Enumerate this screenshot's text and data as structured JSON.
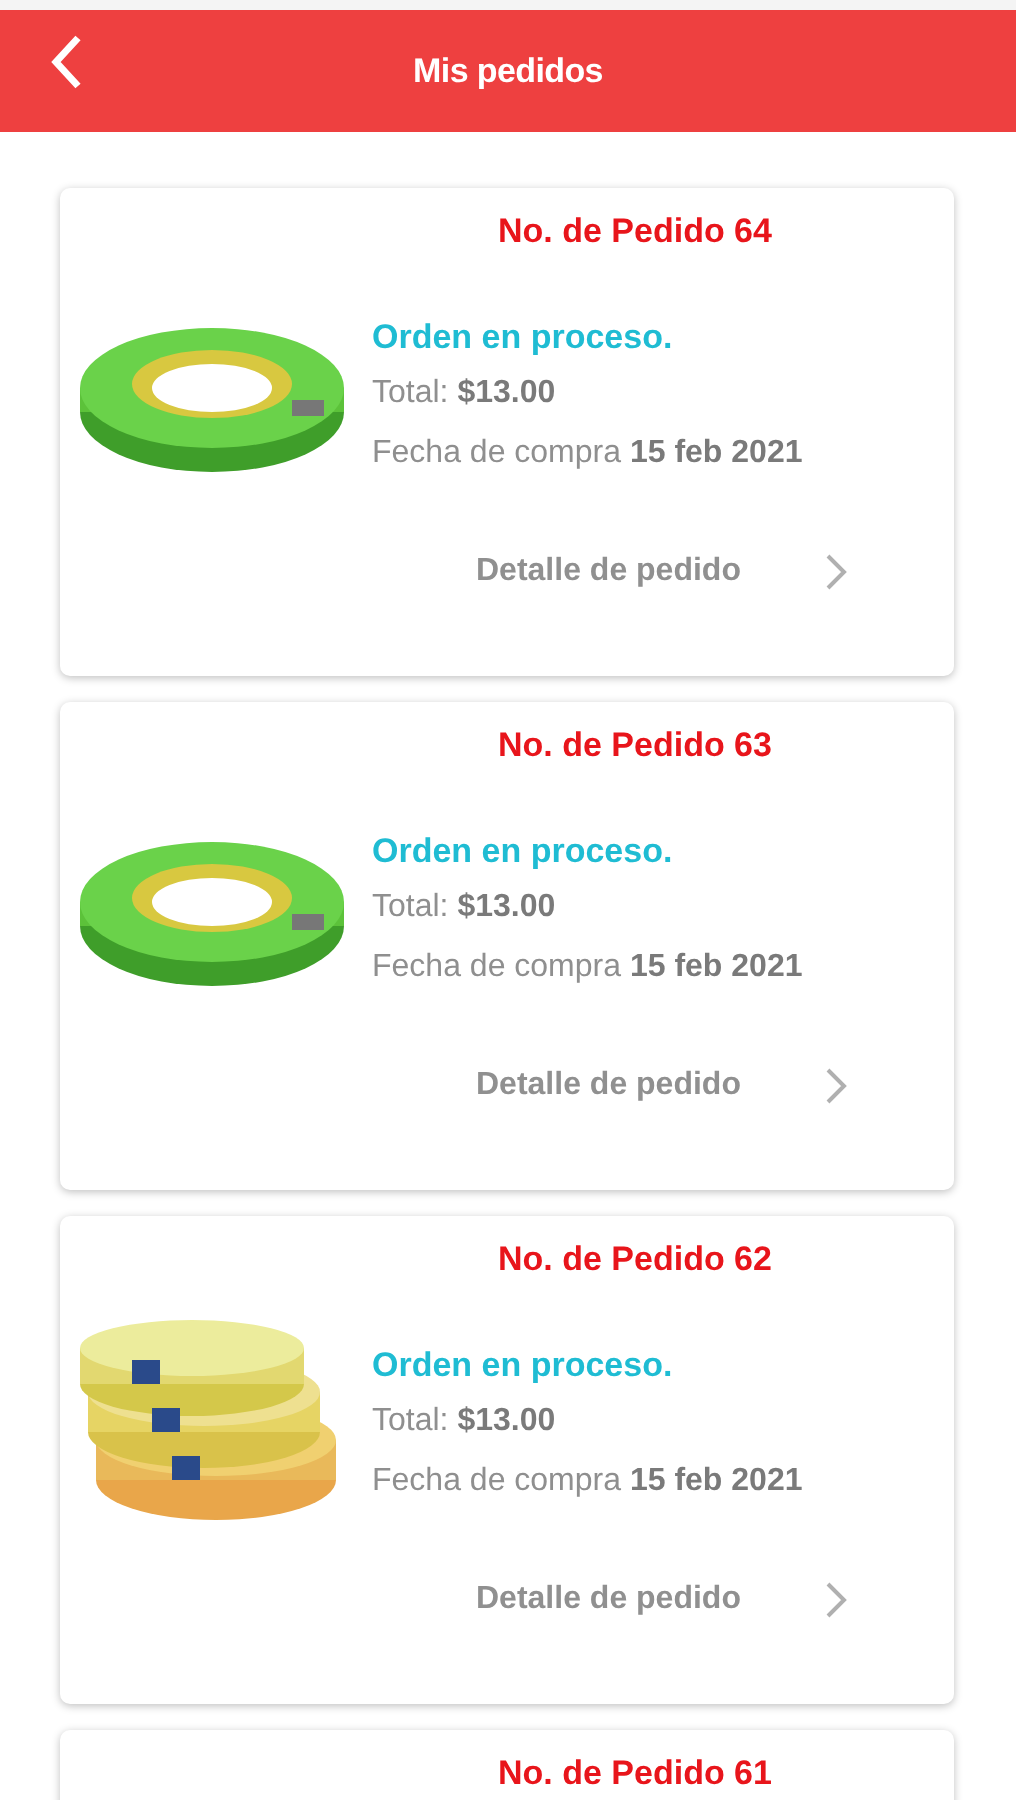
{
  "header": {
    "title": "Mis pedidos"
  },
  "orders": [
    {
      "title": "No. de Pedido 64",
      "status": "Orden en proceso.",
      "total_label": "Total:",
      "total": "$13.00",
      "date_label": "Fecha de compra",
      "date": "15 feb 2021",
      "link": "Detalle de pedido"
    },
    {
      "title": "No. de Pedido 63",
      "status": "Orden en proceso.",
      "total_label": "Total:",
      "total": "$13.00",
      "date_label": "Fecha de compra",
      "date": "15 feb 2021",
      "link": "Detalle de pedido"
    },
    {
      "title": "No. de Pedido 62",
      "status": "Orden en proceso.",
      "total_label": "Total:",
      "total": "$13.00",
      "date_label": "Fecha de compra",
      "date": "15 feb 2021",
      "link": "Detalle de pedido"
    },
    {
      "title": "No. de Pedido 61"
    }
  ]
}
